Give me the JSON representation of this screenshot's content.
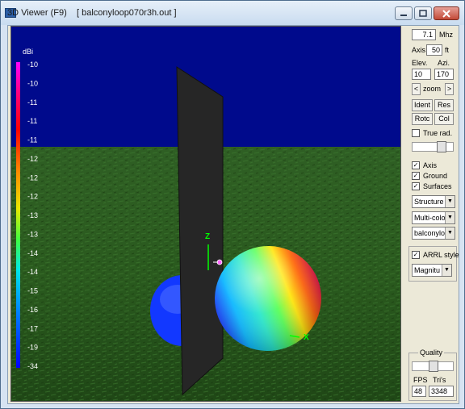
{
  "window": {
    "title": "3D Viewer (F9)    [ balconyloop070r3h.out ]",
    "controls": [
      "minimize",
      "maximize",
      "close"
    ]
  },
  "colors": {
    "sky": "#000a8c",
    "ground": "#2a5a1c",
    "panel_bg": "#ece9d8",
    "plate": "#2a2a2a"
  },
  "legend": {
    "unit": "dBi",
    "values": [
      "-10",
      "-10",
      "-11",
      "-11",
      "-11",
      "-12",
      "-12",
      "-12",
      "-13",
      "-13",
      "-14",
      "-14",
      "-15",
      "-16",
      "-17",
      "-19",
      "-34"
    ]
  },
  "axes_labels": {
    "z": "Z",
    "x": "X"
  },
  "panel": {
    "freq_value": "7.1",
    "freq_unit": "Mhz",
    "axis_label": "Axis",
    "axis_value": "50",
    "axis_unit": "ft",
    "elev_label": "Elev.",
    "azi_label": "Azi.",
    "elev_value": "10",
    "azi_value": "170",
    "zoom_left": "<",
    "zoom_label": "zoom",
    "zoom_right": ">",
    "ident_label": "Ident",
    "res_label": "Res",
    "rotc_label": "Rotc",
    "col_label": "Col",
    "true_rad_label": "True rad.",
    "true_rad_checked": false,
    "axis_check_label": "Axis",
    "axis_checked": true,
    "ground_check_label": "Ground",
    "ground_checked": true,
    "surfaces_check_label": "Surfaces",
    "surfaces_checked": true,
    "structure_select": "Structure",
    "color_select": "Multi-colo",
    "file_select": "balconylo",
    "arrl_label": "ARRL style",
    "arrl_checked": true,
    "magnitude_select": "Magnitu",
    "quality_label": "Quality",
    "fps_label": "FPS",
    "tris_label": "Tri's",
    "fps_value": "48",
    "tris_value": "3348"
  }
}
